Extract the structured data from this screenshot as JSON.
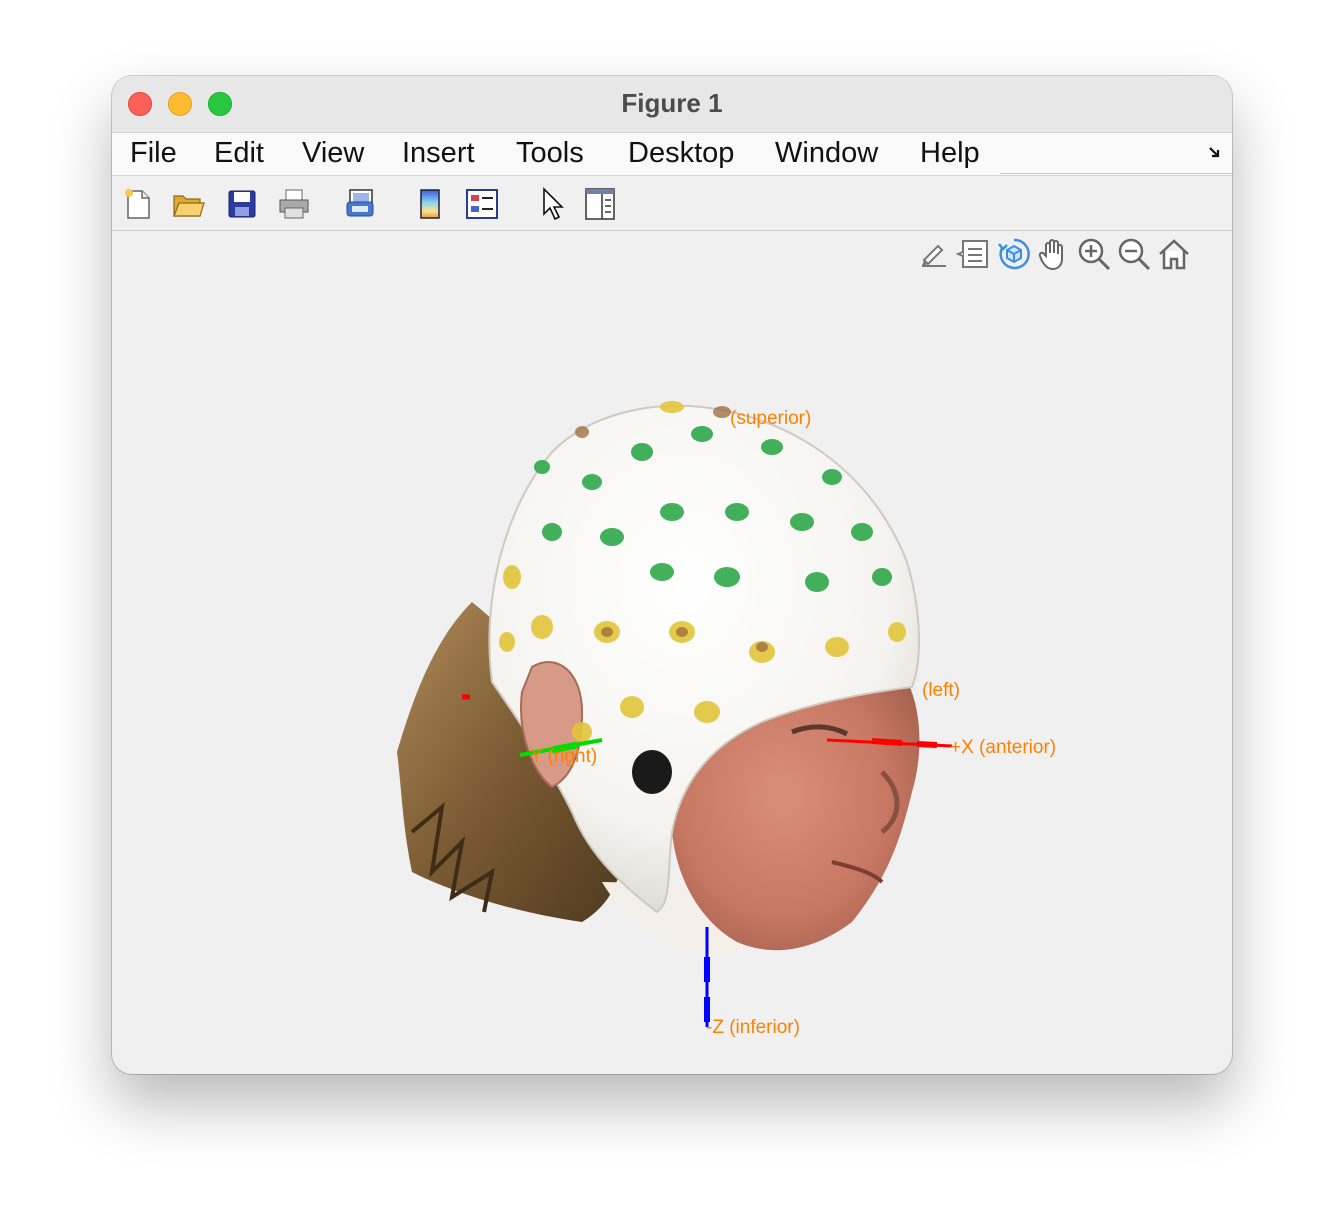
{
  "window": {
    "title": "Figure 1"
  },
  "menubar": {
    "items": [
      "File",
      "Edit",
      "View",
      "Insert",
      "Tools",
      "Desktop",
      "Window",
      "Help"
    ]
  },
  "toolbar": {
    "buttons": [
      "new-figure-icon",
      "open-folder-icon",
      "save-icon",
      "print-icon",
      "link-plot-icon",
      "insert-colorbar-icon",
      "insert-legend-icon",
      "edit-pointer-icon",
      "property-inspector-icon"
    ]
  },
  "axes_toolbar": {
    "buttons": [
      "brush-icon",
      "data-tips-icon",
      "rotate-3d-icon",
      "pan-hand-icon",
      "zoom-in-icon",
      "zoom-out-icon",
      "restore-view-home-icon"
    ],
    "active": "rotate-3d-icon"
  },
  "axes": {
    "superior_label": "(superior)",
    "left_label": "(left)",
    "anterior_label": "+X (anterior)",
    "right_label": "Y (right)",
    "inferior_label": "-Z (inferior)",
    "label_color": "#ff8000",
    "x_color": "#ff0000",
    "y_color": "#00dd00",
    "z_color": "#0000ff"
  }
}
